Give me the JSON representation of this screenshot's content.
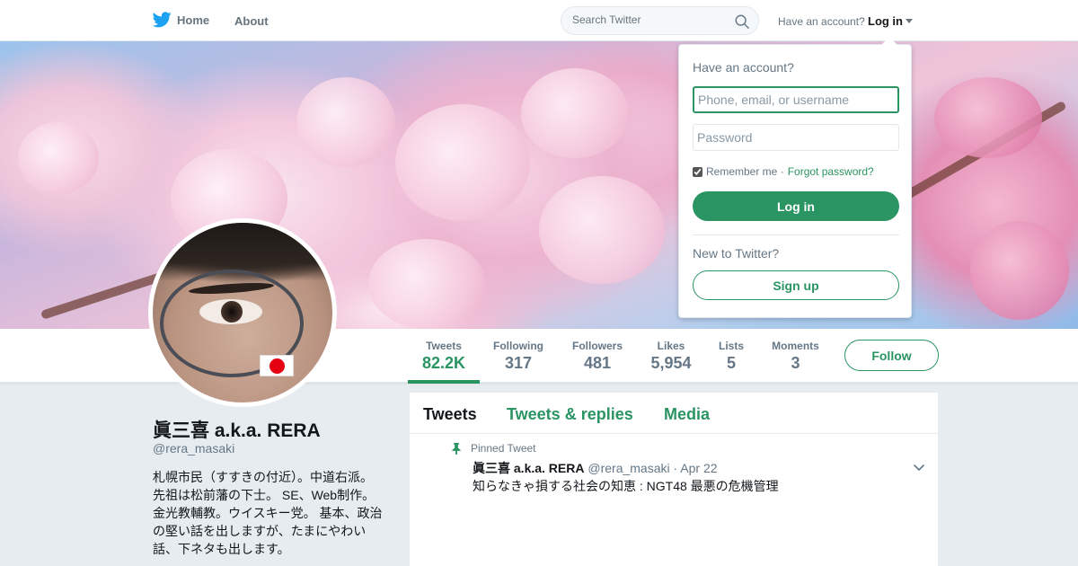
{
  "nav": {
    "home_label": "Home",
    "about_label": "About",
    "search_placeholder": "Search Twitter",
    "have_account_text": "Have an account?",
    "login_label": "Log in"
  },
  "profile": {
    "display_name": "眞三喜 a.k.a. RERA",
    "handle": "@rera_masaki",
    "bio_lines": [
      "札幌市民（すすきの付近）。中道右派。",
      "先祖は松前藩の下士。 SE、Web制作。",
      "金光教輔教。ウイスキー党。 基本、政治",
      "の堅い話を出しますが、たまにやわい",
      "話、下ネタも出します。"
    ],
    "follow_label": "Follow"
  },
  "stats": [
    {
      "label": "Tweets",
      "value": "82.2K",
      "active": true
    },
    {
      "label": "Following",
      "value": "317"
    },
    {
      "label": "Followers",
      "value": "481"
    },
    {
      "label": "Likes",
      "value": "5,954"
    },
    {
      "label": "Lists",
      "value": "5"
    },
    {
      "label": "Moments",
      "value": "3"
    }
  ],
  "timeline": {
    "tabs": [
      "Tweets",
      "Tweets & replies",
      "Media"
    ],
    "pinned_label": "Pinned Tweet",
    "tweet": {
      "name": "眞三喜 a.k.a. RERA",
      "handle": "@rera_masaki",
      "date_sep": "· Apr 22",
      "text": "知らなきゃ損する社会の知恵 : NGT48 最悪の危機管理"
    }
  },
  "login_dropdown": {
    "title": "Have an account?",
    "username_placeholder": "Phone, email, or username",
    "password_placeholder": "Password",
    "remember_label": "Remember me ·",
    "forgot_label": "Forgot password?",
    "login_button": "Log in",
    "new_text": "New to Twitter?",
    "signup_button": "Sign up"
  },
  "colors": {
    "accent": "#2b9463",
    "twitter_blue": "#1da1f2",
    "muted": "#657786"
  },
  "icons": [
    "twitter-bird-icon",
    "search-icon",
    "pin-icon",
    "chevron-down-icon",
    "japan-flag-icon"
  ]
}
